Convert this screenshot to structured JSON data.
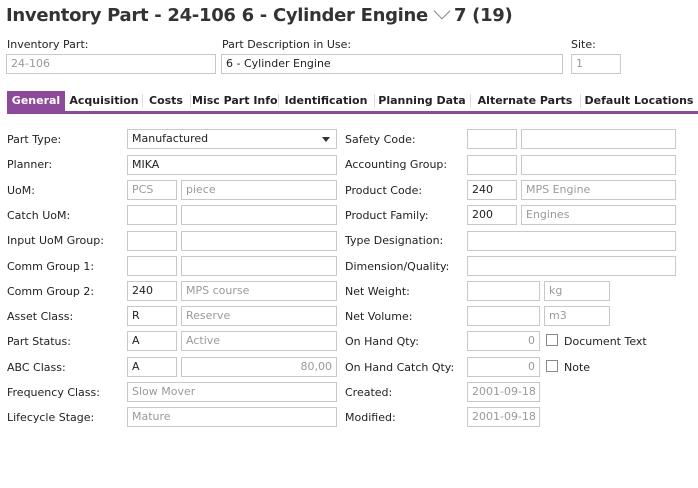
{
  "header": {
    "prefix": "Inventory Part - 24-106 6 - Cylinder Engine",
    "count": "7 (19)"
  },
  "top_fields": {
    "inventory_part_label": "Inventory Part:",
    "inventory_part_value": "24-106",
    "description_label": "Part Description in Use:",
    "description_value": "6 - Cylinder Engine",
    "site_label": "Site:",
    "site_value": "1"
  },
  "tabs": [
    "General",
    "Acquisition",
    "Costs",
    "Misc Part Info",
    "Identification",
    "Planning Data",
    "Alternate Parts",
    "Default Locations"
  ],
  "left": {
    "part_type_label": "Part Type:",
    "part_type_value": "Manufactured",
    "planner_label": "Planner:",
    "planner_value": "MIKA",
    "uom_label": "UoM:",
    "uom_code": "PCS",
    "uom_desc": "piece",
    "catch_uom_label": "Catch UoM:",
    "input_uom_group_label": "Input UoM Group:",
    "comm_group1_label": "Comm Group 1:",
    "comm_group2_label": "Comm Group 2:",
    "comm_group2_code": "240",
    "comm_group2_desc": "MPS course",
    "asset_class_label": "Asset Class:",
    "asset_class_code": "R",
    "asset_class_desc": "Reserve",
    "part_status_label": "Part Status:",
    "part_status_code": "A",
    "part_status_desc": "Active",
    "abc_class_label": "ABC Class:",
    "abc_class_code": "A",
    "abc_class_value": "80,00",
    "frequency_class_label": "Frequency Class:",
    "frequency_class_value": "Slow Mover",
    "lifecycle_stage_label": "Lifecycle Stage:",
    "lifecycle_stage_value": "Mature"
  },
  "right": {
    "safety_code_label": "Safety Code:",
    "accounting_group_label": "Accounting Group:",
    "product_code_label": "Product Code:",
    "product_code_code": "240",
    "product_code_desc": "MPS Engine",
    "product_family_label": "Product Family:",
    "product_family_code": "200",
    "product_family_desc": "Engines",
    "type_designation_label": "Type Designation:",
    "dimension_quality_label": "Dimension/Quality:",
    "net_weight_label": "Net Weight:",
    "net_weight_unit": "kg",
    "net_volume_label": "Net Volume:",
    "net_volume_unit": "m3",
    "on_hand_qty_label": "On Hand Qty:",
    "on_hand_qty_value": "0",
    "on_hand_catch_qty_label": "On Hand Catch Qty:",
    "on_hand_catch_qty_value": "0",
    "document_text_label": "Document Text",
    "note_label": "Note",
    "created_label": "Created:",
    "created_value": "2001-09-18",
    "modified_label": "Modified:",
    "modified_value": "2001-09-18"
  }
}
